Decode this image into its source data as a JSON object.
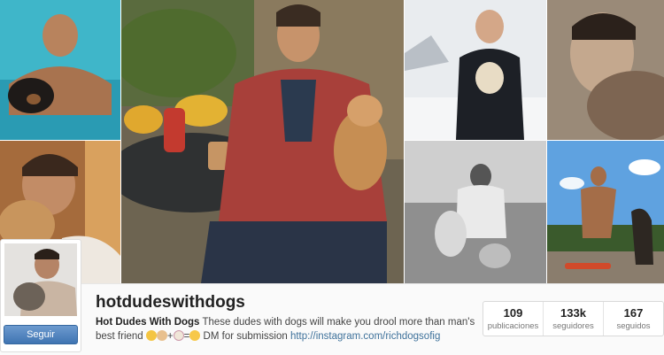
{
  "profile": {
    "username": "hotdudeswithdogs",
    "display_name": "Hot Dudes With Dogs",
    "bio_text": "These dudes with dogs will make you drool more than man's best friend",
    "bio_submission": "DM for submission",
    "link": "http://instagram.com/richdogsofig",
    "follow_label": "Seguir"
  },
  "stats": [
    {
      "value": "109",
      "label": "publicaciones"
    },
    {
      "value": "133k",
      "label": "seguidores"
    },
    {
      "value": "167",
      "label": "seguidos"
    }
  ],
  "colors": {
    "follow_button": "#3f74b2",
    "link": "#3f729b"
  }
}
